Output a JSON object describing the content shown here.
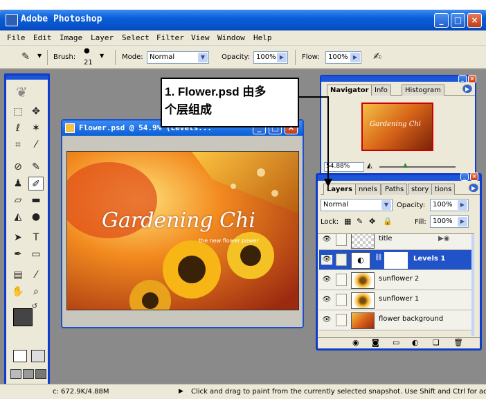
{
  "window": {
    "title": "Adobe Photoshop"
  },
  "menu": [
    "File",
    "Edit",
    "Image",
    "Layer",
    "Select",
    "Filter",
    "View",
    "Window",
    "Help"
  ],
  "options": {
    "brush_label": "Brush:",
    "brush_size": "21",
    "mode_label": "Mode:",
    "mode_value": "Normal",
    "opacity_label": "Opacity:",
    "opacity_value": "100%",
    "flow_label": "Flow:",
    "flow_value": "100%"
  },
  "document": {
    "title": "Flower.psd @ 54.9% (Levels...",
    "image_main_text": "Gardening Chi",
    "image_sub_text": "the new flower power"
  },
  "callout": {
    "line1": "1.  Flower.psd  由多",
    "line2": "个层组成"
  },
  "navigator": {
    "tabs": [
      "Navigator",
      "Info",
      "Histogram"
    ],
    "zoom": "54.88%",
    "thumb_text": "Gardening Chi"
  },
  "layers": {
    "tabs": [
      "Layers",
      "nnels",
      "Paths",
      "story",
      "tions"
    ],
    "blend": "Normal",
    "opacity_label": "Opacity:",
    "opacity_value": "100%",
    "lock_label": "Lock:",
    "fill_label": "Fill:",
    "fill_value": "100%",
    "rows": [
      {
        "name": "title"
      },
      {
        "name": "Levels 1"
      },
      {
        "name": "sunflower 2"
      },
      {
        "name": "sunflower 1"
      },
      {
        "name": "flower background"
      }
    ]
  },
  "status": {
    "doc_size": "c: 672.9K/4.88M",
    "hint": "Click and drag to paint from the currently selected snapshot. Use Shift and Ctrl for additi"
  }
}
